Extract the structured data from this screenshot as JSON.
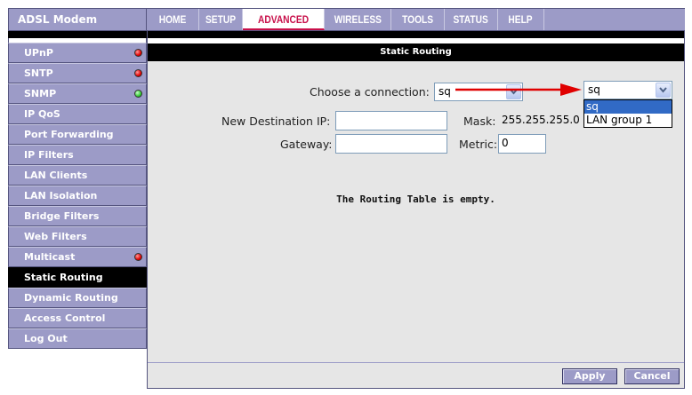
{
  "brand": "ADSL Modem",
  "nav": [
    {
      "label": "HOME",
      "active": false
    },
    {
      "label": "SETUP",
      "active": false
    },
    {
      "label": "ADVANCED",
      "active": true
    },
    {
      "label": "WIRELESS",
      "active": false
    },
    {
      "label": "TOOLS",
      "active": false
    },
    {
      "label": "STATUS",
      "active": false
    },
    {
      "label": "HELP",
      "active": false
    }
  ],
  "sidebar": [
    {
      "label": "UPnP",
      "status": "red"
    },
    {
      "label": "SNTP",
      "status": "red"
    },
    {
      "label": "SNMP",
      "status": "green"
    },
    {
      "label": "IP QoS",
      "status": ""
    },
    {
      "label": "Port Forwarding",
      "status": ""
    },
    {
      "label": "IP Filters",
      "status": ""
    },
    {
      "label": "LAN Clients",
      "status": ""
    },
    {
      "label": "LAN Isolation",
      "status": ""
    },
    {
      "label": "Bridge Filters",
      "status": ""
    },
    {
      "label": "Web Filters",
      "status": ""
    },
    {
      "label": "Multicast",
      "status": "red"
    },
    {
      "label": "Static Routing",
      "status": "",
      "active": true
    },
    {
      "label": "Dynamic Routing",
      "status": ""
    },
    {
      "label": "Access Control",
      "status": ""
    },
    {
      "label": "Log Out",
      "status": ""
    }
  ],
  "page": {
    "title": "Static Routing",
    "connection_label": "Choose a connection:",
    "connection_value": "sq",
    "connection_value_2": "sq",
    "connection_options": [
      "sq",
      "LAN group 1"
    ],
    "dest_ip_label": "New Destination IP:",
    "dest_ip_value": "",
    "mask_label": "Mask:",
    "mask_value": "255.255.255.0",
    "gateway_label": "Gateway:",
    "gateway_value": "",
    "metric_label": "Metric:",
    "metric_value": "0",
    "empty_message": "The Routing Table is empty.",
    "apply_label": "Apply",
    "cancel_label": "Cancel"
  },
  "colors": {
    "nav_bg": "#9c9bc7",
    "active_tab": "#c8104a",
    "annotation_arrow": "#e00000"
  }
}
